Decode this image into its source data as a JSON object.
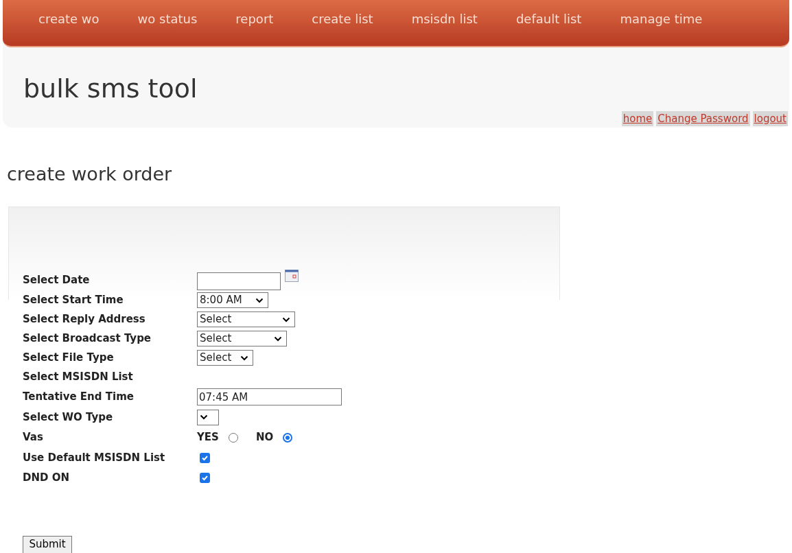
{
  "nav": [
    {
      "label": "create wo",
      "selected": false
    },
    {
      "label": "wo status",
      "selected": false
    },
    {
      "label": "report",
      "selected": false
    },
    {
      "label": "create list",
      "selected": false
    },
    {
      "label": "msisdn list",
      "selected": false
    },
    {
      "label": "default list",
      "selected": false
    },
    {
      "label": "manage time",
      "selected": false
    }
  ],
  "site_title": "bulk sms tool",
  "user_links": [
    "home",
    "Change Password",
    "logout"
  ],
  "page_title": "create work order",
  "form": {
    "rows": [
      {
        "label": "Select Date",
        "kind": "date",
        "value": ""
      },
      {
        "label": "Select Start Time",
        "kind": "select",
        "value": "8:00 AM"
      },
      {
        "label": "Select Reply Address",
        "kind": "select",
        "value": "Select"
      },
      {
        "label": "Select Broadcast Type",
        "kind": "select",
        "value": "Select"
      },
      {
        "label": "Select File Type",
        "kind": "select",
        "value": "Select"
      },
      {
        "label": "Select MSISDN List",
        "kind": "none"
      },
      {
        "label": "Tentative End Time",
        "kind": "text",
        "value": "07:45 AM"
      },
      {
        "label": "Select WO Type",
        "kind": "select",
        "value": ""
      },
      {
        "label": "Vas",
        "kind": "radio",
        "options": [
          {
            "label": "YES",
            "selected": false
          },
          {
            "label": "NO",
            "selected": true
          }
        ]
      },
      {
        "label": "Use Default MSISDN List",
        "kind": "checkbox",
        "checked": true
      },
      {
        "label": "DND ON",
        "kind": "checkbox",
        "checked": true
      }
    ],
    "submit": "Submit"
  }
}
